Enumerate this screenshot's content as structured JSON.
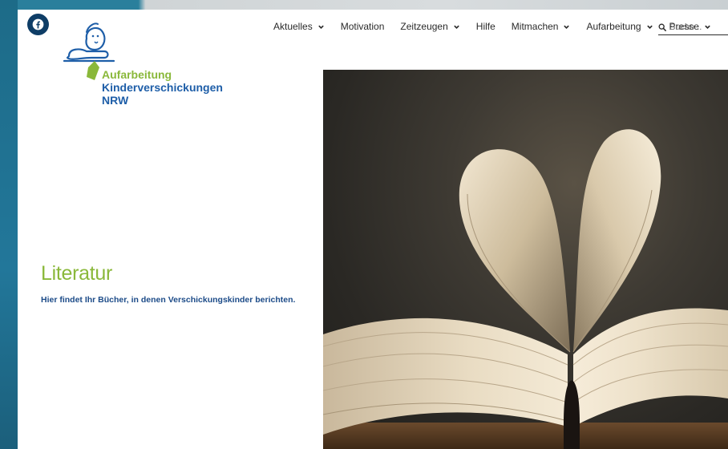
{
  "social": {
    "icon": "facebook-icon"
  },
  "logo": {
    "line1": "Aufarbeitung",
    "line2": "Kinderverschickungen",
    "line3": "NRW"
  },
  "nav": {
    "items": [
      {
        "label": "Aktuelles",
        "dropdown": true
      },
      {
        "label": "Motivation",
        "dropdown": false
      },
      {
        "label": "Zeitzeugen",
        "dropdown": true
      },
      {
        "label": "Hilfe",
        "dropdown": false
      },
      {
        "label": "Mitmachen",
        "dropdown": true
      },
      {
        "label": "Aufarbeitung",
        "dropdown": true
      },
      {
        "label": "Presse",
        "dropdown": true
      }
    ],
    "search_placeholder": "Suche..."
  },
  "content": {
    "title": "Literatur",
    "subtitle": "Hier findet Ihr Bücher, in denen Verschickungskinder berichten."
  },
  "colors": {
    "green": "#8ab83a",
    "blue": "#1e5ea8",
    "dark_blue": "#0e3d66"
  }
}
